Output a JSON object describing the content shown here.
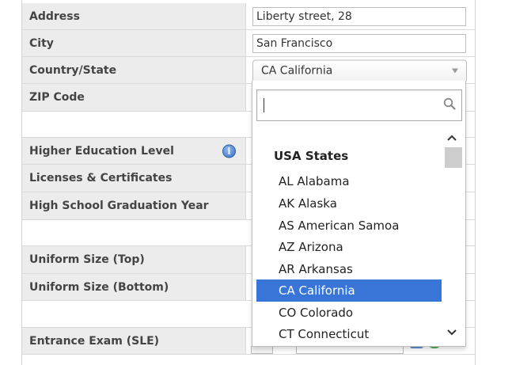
{
  "form": {
    "address": {
      "label": "Address",
      "value": "Liberty street, 28"
    },
    "city": {
      "label": "City",
      "value": "San Francisco"
    },
    "country_state": {
      "label": "Country/State",
      "value": "CA California"
    },
    "zip": {
      "label": "ZIP Code"
    },
    "higher_education": {
      "label": "Higher Education Level",
      "info_icon": "info-icon"
    },
    "licenses": {
      "label": "Licenses & Certificates"
    },
    "graduation_year": {
      "label": "High School Graduation Year"
    },
    "uniform_top": {
      "label": "Uniform Size (Top)"
    },
    "uniform_bottom": {
      "label": "Uniform Size (Bottom)"
    },
    "entrance_exam": {
      "label": "Entrance Exam (SLE)"
    }
  },
  "dropdown": {
    "search_value": "",
    "group": "USA States",
    "options": [
      "AL Alabama",
      "AK Alaska",
      "AS American Samoa",
      "AZ Arizona",
      "AR Arkansas",
      "CA California",
      "CO Colorado",
      "CT Connecticut"
    ],
    "selected": "CA California"
  },
  "colors": {
    "label_bg": "#ececec",
    "selected_bg": "#3875d7",
    "border": "#d4d4d4"
  }
}
